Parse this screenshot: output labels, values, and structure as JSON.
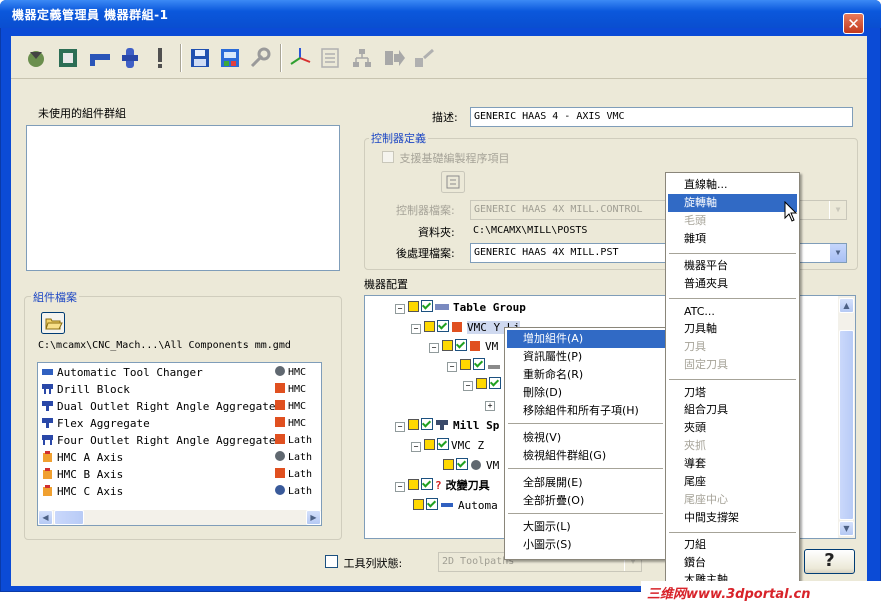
{
  "window": {
    "title": "機器定義管理員 機器群組-1",
    "close": "✕"
  },
  "toolbar": {
    "icons": [
      "open-machine-icon",
      "save-machine-icon",
      "component-icon",
      "axis-icon",
      "warning-icon",
      "save-icon",
      "save-as-icon",
      "wrench-icon",
      "axes-icon",
      "list-icon",
      "tree-icon",
      "export-icon",
      "import-icon"
    ]
  },
  "unused_groups": {
    "title": "未使用的組件群組"
  },
  "description": {
    "label": "描述:",
    "value": "GENERIC HAAS 4 - AXIS VMC"
  },
  "controller": {
    "title": "控制器定義",
    "support_checkbox": "支援基礎編製程序項目",
    "controller_file_label": "控制器檔案:",
    "controller_file_value": "GENERIC HAAS 4X MILL.CONTROL",
    "folder_label": "資料夾:",
    "folder_value": "C:\\MCAMX\\MILL\\POSTS",
    "post_label": "後處理檔案:",
    "post_value": "GENERIC HAAS 4X MILL.PST"
  },
  "component_files": {
    "title": "組件檔案",
    "path": "C:\\mcamx\\CNC_Mach...\\All Components mm.gmd",
    "items": [
      {
        "name": "Automatic Tool Changer",
        "type": "HMC"
      },
      {
        "name": "Drill Block",
        "type": "HMC"
      },
      {
        "name": "Dual Outlet Right Angle Aggregate",
        "type": "HMC"
      },
      {
        "name": "Flex Aggregate",
        "type": "HMC"
      },
      {
        "name": "Four Outlet Right Angle Aggregate",
        "type": "Lath"
      },
      {
        "name": "HMC A Axis",
        "type": "Lath"
      },
      {
        "name": "HMC B Axis",
        "type": "Lath"
      },
      {
        "name": "HMC C Axis",
        "type": "Lath"
      }
    ]
  },
  "machine_config": {
    "title": "機器配置",
    "tree": [
      {
        "label": "Table Group",
        "bold": true
      },
      {
        "label": "VMC Y Li"
      },
      {
        "label": "VM"
      },
      {
        "label": ""
      },
      {
        "label": ""
      },
      {
        "label": ""
      },
      {
        "label": "Mill Sp",
        "bold": true
      },
      {
        "label": "VMC Z"
      },
      {
        "label": "VM"
      },
      {
        "label": "改變刀具",
        "bold": true
      },
      {
        "label": "Automa"
      }
    ]
  },
  "context_menu": {
    "items": [
      {
        "label": "增加組件(A)",
        "selected": true,
        "submenu": true
      },
      {
        "label": "資訊屬性(P)"
      },
      {
        "label": "重新命名(R)"
      },
      {
        "label": "刪除(D)"
      },
      {
        "label": "移除組件和所有子項(H)"
      },
      {
        "label": "檢視(V)"
      },
      {
        "label": "檢視組件群組(G)"
      },
      {
        "label": "全部展開(E)"
      },
      {
        "label": "全部折疊(O)"
      },
      {
        "label": "大圖示(L)"
      },
      {
        "label": "小圖示(S)"
      }
    ]
  },
  "submenu": {
    "items": [
      {
        "label": "直線軸..."
      },
      {
        "label": "旋轉軸",
        "selected": true
      },
      {
        "label": "毛頭",
        "disabled": true
      },
      {
        "label": "雜項"
      },
      {
        "label": "機器平台"
      },
      {
        "label": "普通夾具"
      },
      {
        "label": "ATC..."
      },
      {
        "label": "刀具軸"
      },
      {
        "label": "刀具",
        "disabled": true
      },
      {
        "label": "固定刀具",
        "disabled": true
      },
      {
        "label": "刀塔"
      },
      {
        "label": "組合刀具"
      },
      {
        "label": "夾頭"
      },
      {
        "label": "夾抓",
        "disabled": true
      },
      {
        "label": "導套"
      },
      {
        "label": "尾座"
      },
      {
        "label": "尾座中心",
        "disabled": true
      },
      {
        "label": "中間支撐架"
      },
      {
        "label": "刀組"
      },
      {
        "label": "鑽台"
      },
      {
        "label": "木雕主軸"
      }
    ]
  },
  "toolbar_state": {
    "label": "工具列狀態:",
    "value": "2D Toolpaths"
  },
  "help_button": {
    "label": "?"
  },
  "watermark": {
    "text": "三维网www.3dportal.cn"
  },
  "colors": {
    "titlebar": "#0b58dc",
    "selection": "#316ac5",
    "dialog": "#ece9d8"
  }
}
